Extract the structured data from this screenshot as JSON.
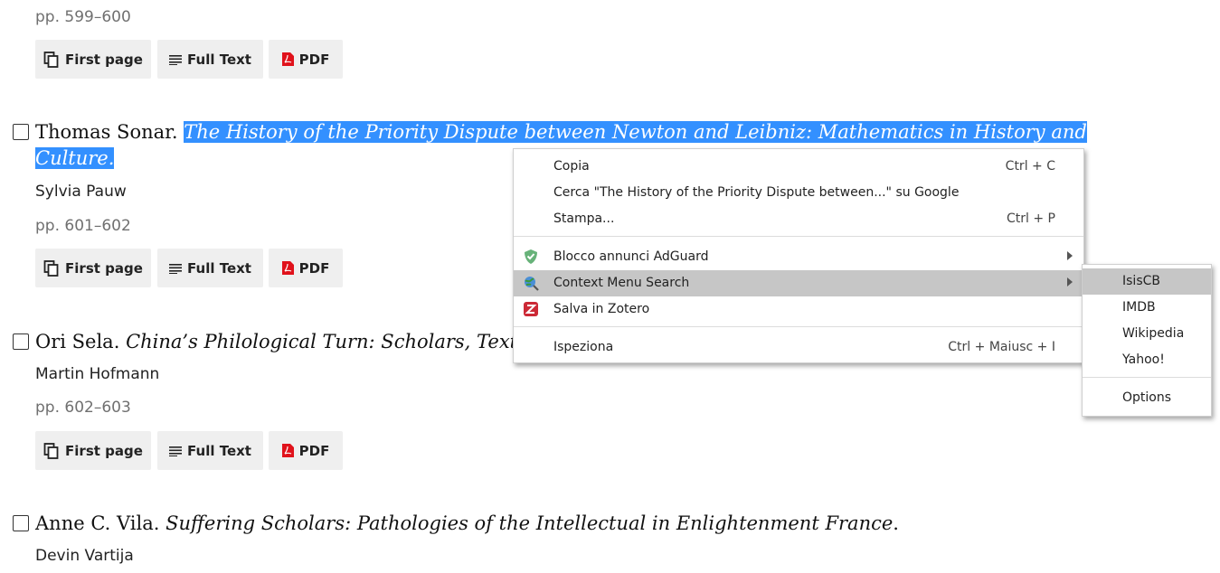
{
  "entries": [
    {
      "pages": "pp. 599–600",
      "buttons": {
        "first_page": "First page",
        "full_text": "Full Text",
        "pdf": "PDF"
      }
    },
    {
      "author": "Thomas Sonar.",
      "title_line1": "The History of the Priority Dispute between Newton and Leibniz: Mathematics in History and",
      "title_line2": "Culture.",
      "reviewer": "Sylvia Pauw",
      "pages": "pp. 601–602",
      "buttons": {
        "first_page": "First page",
        "full_text": "Full Text",
        "pdf": "PDF"
      }
    },
    {
      "author": "Ori Sela.",
      "title": "China’s Philological Turn: Scholars, Textua",
      "reviewer": "Martin Hofmann",
      "pages": "pp. 602–603",
      "buttons": {
        "first_page": "First page",
        "full_text": "Full Text",
        "pdf": "PDF"
      }
    },
    {
      "author": "Anne C. Vila.",
      "title": "Suffering Scholars: Pathologies of the Intellectual in Enlightenment France",
      "title_end": ".",
      "reviewer": "Devin Vartija"
    }
  ],
  "context_menu": {
    "items": [
      {
        "label": "Copia",
        "shortcut": "Ctrl + C"
      },
      {
        "label": "Cerca \"The History of the Priority Dispute between...\" su Google"
      },
      {
        "label": "Stampa...",
        "shortcut": "Ctrl + P"
      },
      {
        "label": "Blocco annunci AdGuard",
        "icon": "adguard-shield-icon"
      },
      {
        "label": "Context Menu Search",
        "icon": "globe-search-icon",
        "highlighted": true
      },
      {
        "label": "Salva in Zotero",
        "icon": "zotero-icon"
      },
      {
        "label": "Ispeziona",
        "shortcut": "Ctrl + Maiusc + I"
      }
    ],
    "submenu": [
      "IsisCB",
      "IMDB",
      "Wikipedia",
      "Yahoo!",
      "Options"
    ]
  },
  "colors": {
    "selection": "#3390ff",
    "button_bg": "#efefef",
    "menu_highlight": "#c6c6c6",
    "pdf_red": "#e0121b"
  }
}
